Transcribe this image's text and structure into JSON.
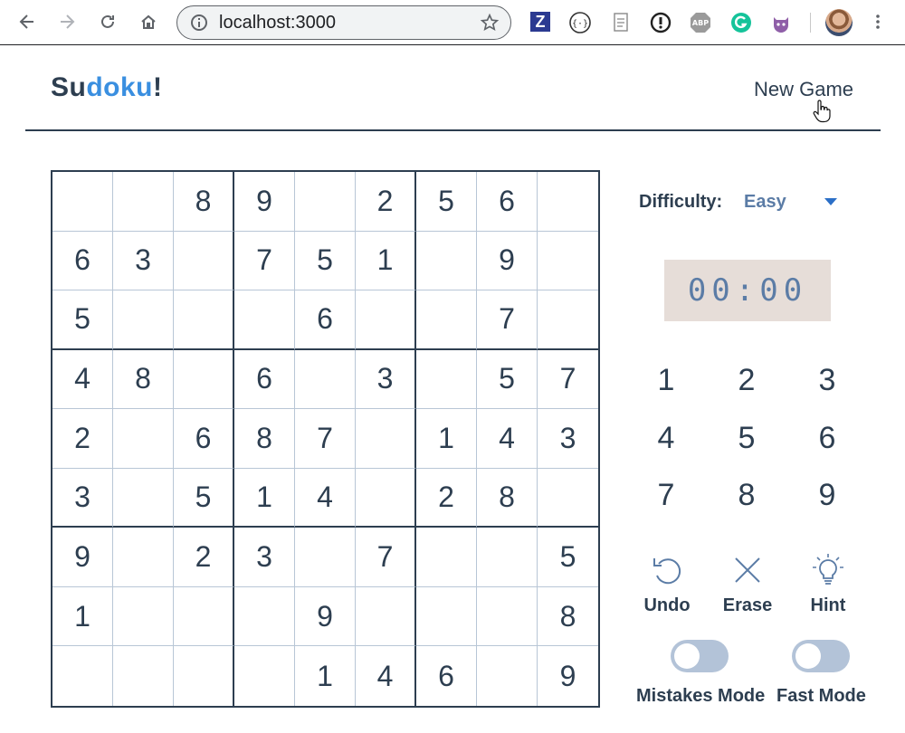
{
  "browser": {
    "url": "localhost:3000"
  },
  "app": {
    "logo_part1": "Su",
    "logo_part2": "doku",
    "logo_part3": "!",
    "new_game": "New Game"
  },
  "board": [
    [
      "",
      "",
      "8",
      "9",
      "",
      "2",
      "5",
      "6",
      ""
    ],
    [
      "6",
      "3",
      "",
      "7",
      "5",
      "1",
      "",
      "9",
      ""
    ],
    [
      "5",
      "",
      "",
      "",
      "6",
      "",
      "",
      "7",
      ""
    ],
    [
      "4",
      "8",
      "",
      "6",
      "",
      "3",
      "",
      "5",
      "7"
    ],
    [
      "2",
      "",
      "6",
      "8",
      "7",
      "",
      "1",
      "4",
      "3"
    ],
    [
      "3",
      "",
      "5",
      "1",
      "4",
      "",
      "2",
      "8",
      ""
    ],
    [
      "9",
      "",
      "2",
      "3",
      "",
      "7",
      "",
      "",
      "5"
    ],
    [
      "1",
      "",
      "",
      "",
      "9",
      "",
      "",
      "",
      "8"
    ],
    [
      "",
      "",
      "",
      "",
      "1",
      "4",
      "6",
      "",
      "9"
    ]
  ],
  "panel": {
    "difficulty_label": "Difficulty:",
    "difficulty_value": "Easy",
    "timer": "00:00",
    "numpad": [
      "1",
      "2",
      "3",
      "4",
      "5",
      "6",
      "7",
      "8",
      "9"
    ],
    "actions": {
      "undo": "Undo",
      "erase": "Erase",
      "hint": "Hint"
    },
    "toggles": {
      "mistakes_mode": "Mistakes Mode",
      "fast_mode": "Fast Mode"
    }
  },
  "colors": {
    "primary": "#2d3e50",
    "accent": "#3a8fe0",
    "muted_blue": "#5b7ca6",
    "toggle_off": "#b3c3d8",
    "timer_bg": "#e6ddd8"
  }
}
